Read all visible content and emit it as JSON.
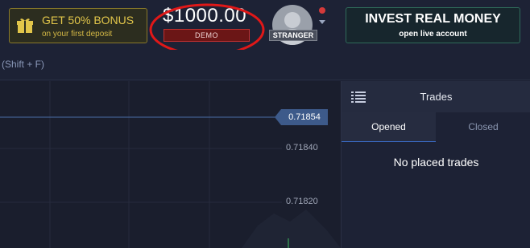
{
  "header": {
    "bonus": {
      "title": "GET 50% BONUS",
      "subtitle": "on your first deposit"
    },
    "balance": {
      "amount": "$1000.00",
      "account_type": "DEMO"
    },
    "user": {
      "name": "STRANGER"
    },
    "invest": {
      "title": "INVEST REAL MONEY",
      "subtitle": "open live account"
    }
  },
  "search": {
    "hint": "(Shift + F)"
  },
  "chart": {
    "current_price": "0.71854",
    "axis_labels": [
      "0.71840",
      "0.71820"
    ]
  },
  "trades": {
    "title": "Trades",
    "tabs": {
      "opened": "Opened",
      "closed": "Closed"
    },
    "empty_message": "No placed trades"
  },
  "colors": {
    "background": "#1d2235",
    "bonus_accent": "#e2c64a",
    "demo_red": "#c23030",
    "price_tag": "#3d5a8a",
    "tab_active_underline": "#3b6fcf"
  }
}
